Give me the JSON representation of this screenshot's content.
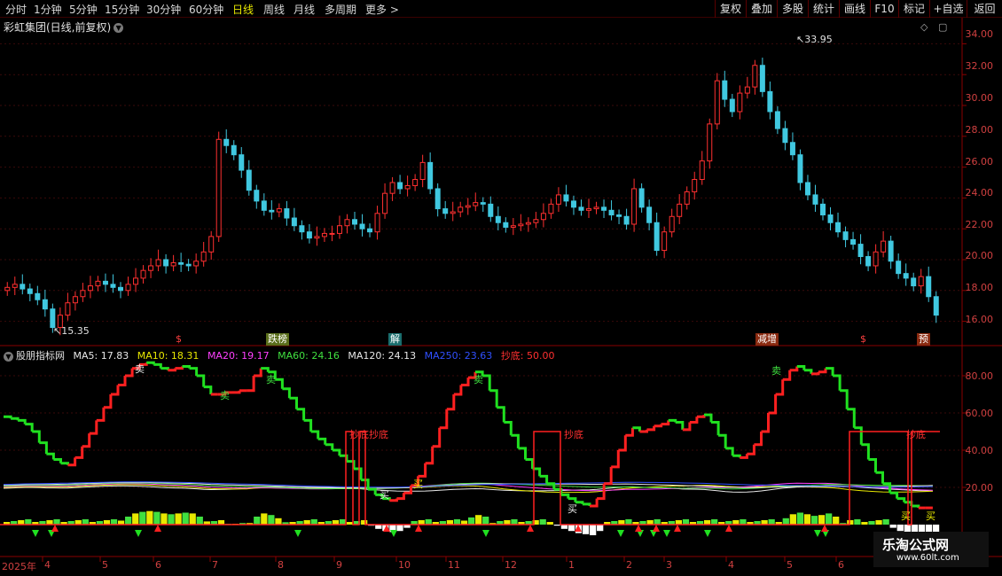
{
  "toolbar": {
    "period_tabs": [
      "分时",
      "1分钟",
      "5分钟",
      "15分钟",
      "30分钟",
      "60分钟",
      "日线",
      "周线",
      "月线",
      "多周期",
      "更多 >"
    ],
    "active_tab": "日线",
    "right_buttons": [
      "复权",
      "叠加",
      "多股",
      "统计",
      "画线",
      "F10",
      "标记",
      "+自选",
      "返回"
    ]
  },
  "main_chart": {
    "title": "彩虹集团(日线,前复权)",
    "high_label": "33.95",
    "low_label": "15.35",
    "y_ticks": [
      "34.00",
      "32.00",
      "30.00",
      "28.00",
      "26.00",
      "24.00",
      "22.00",
      "20.00",
      "18.00",
      "16.00"
    ],
    "markers": [
      "$",
      "跌榜",
      "解",
      "减增",
      "$",
      "预"
    ]
  },
  "indicator": {
    "name": "股朋指标网",
    "items": [
      {
        "label": "MA5: 17.83",
        "color": "#e8e8e8"
      },
      {
        "label": "MA10: 18.31",
        "color": "#e8e800"
      },
      {
        "label": "MA20: 19.17",
        "color": "#ff40ff"
      },
      {
        "label": "MA60: 24.16",
        "color": "#40e040"
      },
      {
        "label": "MA120: 24.13",
        "color": "#e8e8e8"
      },
      {
        "label": "MA250: 23.63",
        "color": "#3050ff"
      },
      {
        "label": "抄底: 50.00",
        "color": "#ff3030"
      }
    ],
    "y_ticks": [
      "80.00",
      "60.00",
      "40.00",
      "20.00"
    ],
    "signal_labels": [
      "抄底抄底",
      "抄底",
      "抄底"
    ],
    "buy_label": "买",
    "sell_label": "卖"
  },
  "x_axis": [
    "2025年",
    "4",
    "5",
    "6",
    "7",
    "8",
    "9",
    "10",
    "11",
    "12",
    "1",
    "2",
    "3",
    "4",
    "5",
    "6"
  ],
  "watermark": {
    "title": "乐淘公式网",
    "url": "www.60lt.com"
  },
  "chart_data": {
    "type": "candlestick",
    "title": "彩虹集团(日线,前复权)",
    "xlabel": "",
    "ylabel": "",
    "ylim": [
      15,
      35
    ],
    "x_ticks": [
      "2025年",
      "4",
      "5",
      "6",
      "7",
      "8",
      "9",
      "10",
      "11",
      "12",
      "1",
      "2",
      "3",
      "4",
      "5",
      "6"
    ],
    "annotated_high": 33.95,
    "annotated_low": 15.35,
    "close_series": [
      18.2,
      18.4,
      18.1,
      17.8,
      17.4,
      16.8,
      15.6,
      16.4,
      17.2,
      17.6,
      18.0,
      18.3,
      18.6,
      18.4,
      18.2,
      18.0,
      18.4,
      18.8,
      19.3,
      19.6,
      20.0,
      19.6,
      19.8,
      19.7,
      19.6,
      19.9,
      20.5,
      21.5,
      27.8,
      27.4,
      26.8,
      25.8,
      24.5,
      23.8,
      23.2,
      23.1,
      23.3,
      22.7,
      22.2,
      21.8,
      21.4,
      21.5,
      21.7,
      21.7,
      22.2,
      22.6,
      22.3,
      22.0,
      21.8,
      23.0,
      24.3,
      25.0,
      24.6,
      24.8,
      25.2,
      26.3,
      24.6,
      23.3,
      23.0,
      23.1,
      23.4,
      23.5,
      23.7,
      23.6,
      22.8,
      22.4,
      22.1,
      22.2,
      22.3,
      22.4,
      22.6,
      23.0,
      23.6,
      24.2,
      23.8,
      23.4,
      23.2,
      23.3,
      23.4,
      23.2,
      22.9,
      22.8,
      22.3,
      24.6,
      23.4,
      22.4,
      20.6,
      21.8,
      22.8,
      23.6,
      24.4,
      25.2,
      26.4,
      28.8,
      31.6,
      30.4,
      29.6,
      30.8,
      31.2,
      32.6,
      30.9,
      29.6,
      28.5,
      27.6,
      26.8,
      25.0,
      24.2,
      23.6,
      22.9,
      22.4,
      21.8,
      21.3,
      21.0,
      20.2,
      19.6,
      20.5,
      21.2,
      19.9,
      19.1,
      18.8,
      18.3,
      18.9,
      17.6,
      16.4
    ],
    "indicator_ylim": [
      0,
      100
    ],
    "indicator_series": [
      {
        "name": "MA5",
        "last": 17.83
      },
      {
        "name": "MA10",
        "last": 18.31
      },
      {
        "name": "MA20",
        "last": 19.17
      },
      {
        "name": "MA60",
        "last": 24.16
      },
      {
        "name": "MA120",
        "last": 24.13
      },
      {
        "name": "MA250",
        "last": 23.63
      },
      {
        "name": "抄底",
        "last": 50.0
      }
    ],
    "main_line": [
      58,
      57,
      56,
      54,
      50,
      44,
      38,
      35,
      33,
      32,
      36,
      42,
      49,
      56,
      63,
      70,
      75,
      80,
      84,
      86,
      87,
      86,
      84,
      83,
      84,
      85,
      84,
      80,
      74,
      70,
      70,
      71,
      71,
      72,
      72,
      80,
      84,
      82,
      78,
      73,
      68,
      62,
      56,
      50,
      46,
      43,
      40,
      37,
      34,
      30,
      24,
      19,
      16,
      14,
      13,
      14,
      17,
      21,
      26,
      33,
      42,
      52,
      62,
      70,
      75,
      79,
      82,
      80,
      72,
      63,
      55,
      48,
      41,
      35,
      30,
      26,
      22,
      19,
      16,
      14,
      12,
      11,
      10,
      14,
      22,
      31,
      40,
      48,
      52,
      50,
      51,
      53,
      54,
      56,
      55,
      51,
      55,
      58,
      59,
      55,
      48,
      41,
      37,
      36,
      38,
      43,
      50,
      60,
      70,
      78,
      83,
      85,
      83,
      81,
      82,
      84,
      80,
      72,
      62,
      52,
      43,
      35,
      28,
      22,
      17,
      14,
      12,
      10,
      9,
      9,
      9
    ]
  }
}
